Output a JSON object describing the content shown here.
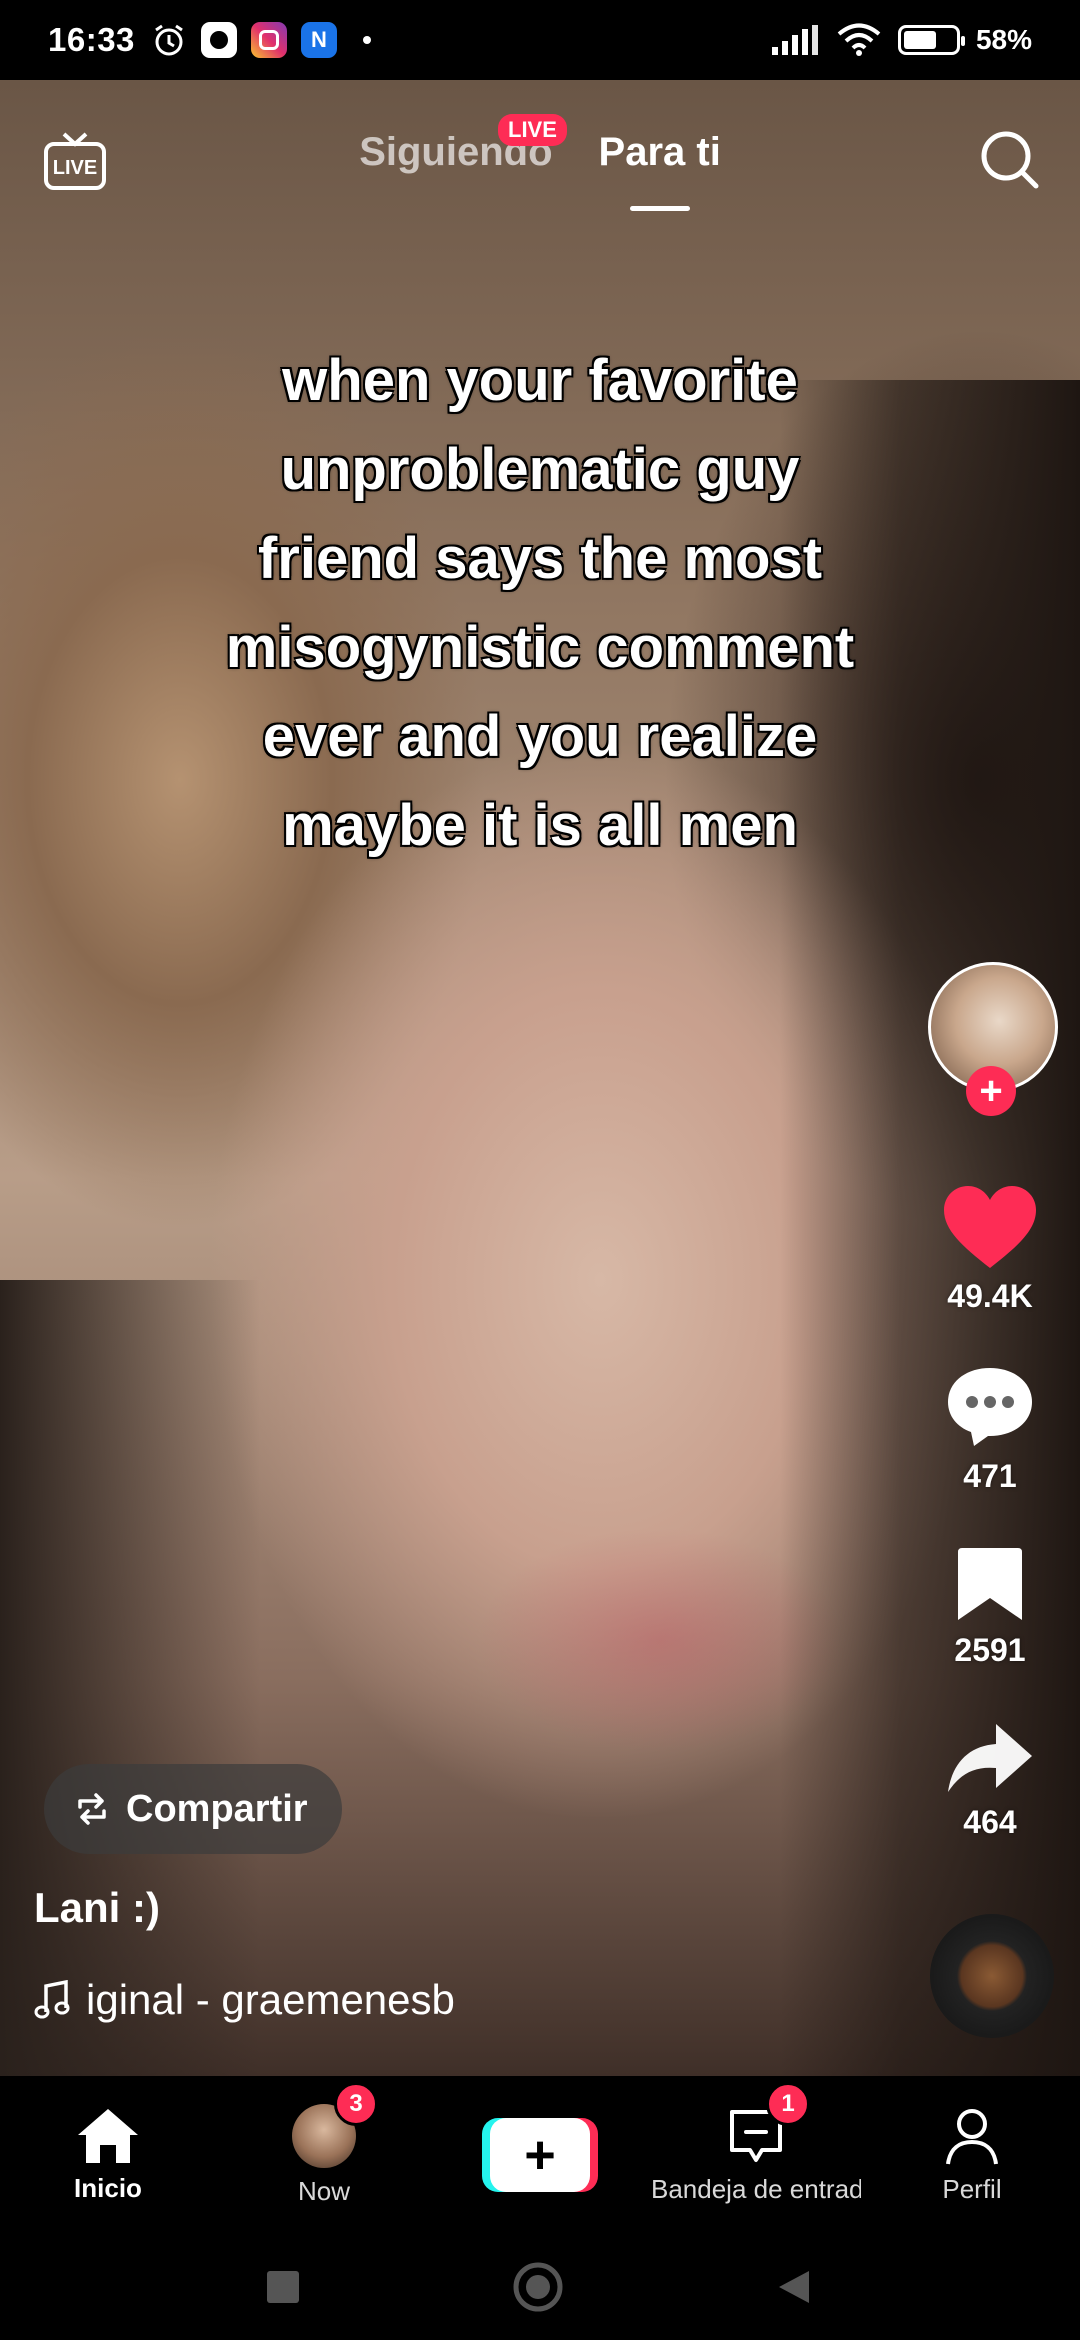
{
  "status_bar": {
    "time": "16:33",
    "battery_percent": "58%",
    "battery_level": 0.58
  },
  "top_nav": {
    "live_icon_text": "LIVE",
    "tabs": [
      {
        "label": "Siguiendo",
        "active": false
      },
      {
        "label": "Para ti",
        "active": true
      }
    ],
    "live_badge": "LIVE"
  },
  "video": {
    "caption_lines": [
      "when your favorite",
      "unproblematic guy",
      "friend says the most",
      "misogynistic comment",
      "ever and you realize",
      "maybe it is all men"
    ],
    "username": "Lani :)",
    "sound": "iginal - graemenesb",
    "share_label": "Compartir"
  },
  "actions": {
    "likes": "49.4K",
    "comments": "471",
    "saves": "2591",
    "shares": "464"
  },
  "bottom_nav": {
    "items": [
      {
        "label": "Inicio",
        "active": true
      },
      {
        "label": "Now",
        "badge": "3"
      },
      {
        "label": ""
      },
      {
        "label": "Bandeja de entrada",
        "badge": "1"
      },
      {
        "label": "Perfil"
      }
    ]
  },
  "colors": {
    "accent": "#fe2c55",
    "cyan": "#25f4ee"
  }
}
